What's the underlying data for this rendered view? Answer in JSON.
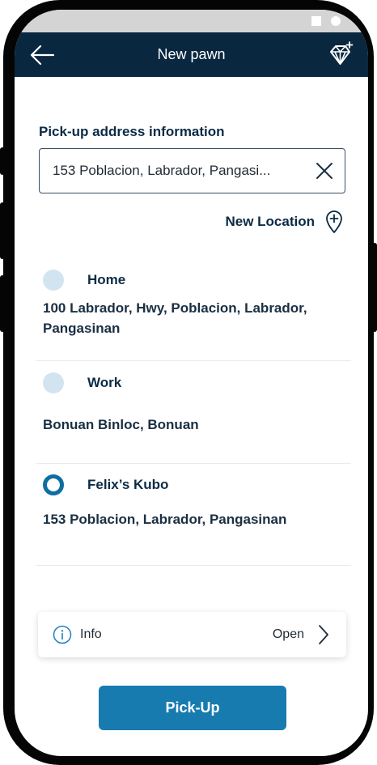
{
  "header": {
    "title": "New pawn",
    "back_icon": "arrow-left-icon",
    "action_icon": "diamond-plus-icon"
  },
  "pickup": {
    "section_label": "Pick-up address information",
    "address_value": "153 Poblacion, Labrador, Pangasi...",
    "clear_icon": "close-icon"
  },
  "new_location": {
    "label": "New Location",
    "icon": "add-location-pin-icon"
  },
  "locations": [
    {
      "name": "Home",
      "address": "100 Labrador, Hwy, Poblacion, Labrador, Pangasinan",
      "selected": false
    },
    {
      "name": "Work",
      "address": "Bonuan Binloc, Bonuan",
      "selected": false
    },
    {
      "name": "Felix’s Kubo",
      "address": "153 Poblacion, Labrador, Pangasinan",
      "selected": true
    }
  ],
  "info": {
    "label": "Info",
    "action": "Open",
    "icon": "info-icon"
  },
  "actions": {
    "pickup_label": "Pick-Up"
  },
  "colors": {
    "header_bg": "#0a2740",
    "accent": "#177bb0",
    "radio_unselected": "#d3e4f1",
    "radio_selected": "#0f6ea3"
  }
}
